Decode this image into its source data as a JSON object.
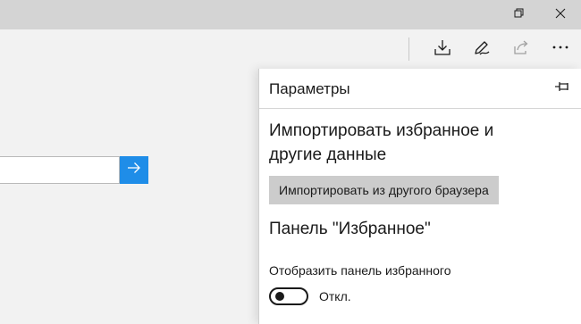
{
  "window": {
    "controls": [
      {
        "name": "restore-icon"
      },
      {
        "name": "close-icon"
      }
    ]
  },
  "toolbar": {
    "buttons": [
      {
        "name": "downloads-icon"
      },
      {
        "name": "pen-icon"
      },
      {
        "name": "share-icon"
      },
      {
        "name": "more-icon"
      }
    ]
  },
  "search": {
    "value": "",
    "go_icon": "arrow-right-icon",
    "accent": "#1f8de8"
  },
  "settings_panel": {
    "title": "Параметры",
    "pin_icon": "pin-icon",
    "import_section_title": "Импортировать избранное и другие данные",
    "import_button_label": "Импортировать из другого браузера",
    "favorites_bar_title": "Панель \"Избранное\"",
    "show_favorites_bar_label": "Отобразить панель избранного",
    "toggle_state_label": "Откл.",
    "toggle_on": false
  }
}
